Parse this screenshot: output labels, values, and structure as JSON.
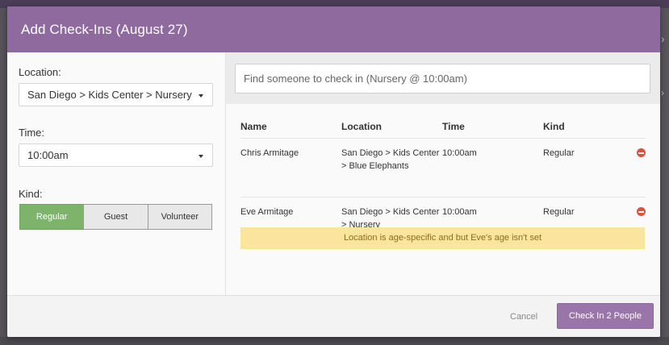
{
  "modal": {
    "title": "Add Check-Ins (August 27)"
  },
  "form": {
    "location_label": "Location:",
    "location_value": "San Diego > Kids Center > Nursery",
    "time_label": "Time:",
    "time_value": "10:00am",
    "kind_label": "Kind:",
    "kind_options": [
      "Regular",
      "Guest",
      "Volunteer"
    ],
    "kind_selected": "Regular"
  },
  "search": {
    "placeholder": "Find someone to check in (Nursery @ 10:00am)"
  },
  "table": {
    "headers": [
      "Name",
      "Location",
      "Time",
      "Kind"
    ],
    "rows": [
      {
        "name": "Chris Armitage",
        "location": "San Diego > Kids Center > Blue Elephants",
        "time": "10:00am",
        "kind": "Regular"
      },
      {
        "name": "Eve Armitage",
        "location": "San Diego > Kids Center > Nursery",
        "time": "10:00am",
        "kind": "Regular"
      }
    ],
    "warning": "Location is age-specific and but Eve's age isn't set"
  },
  "footer": {
    "cancel_label": "Cancel",
    "submit_label": "Check In 2 People"
  },
  "colors": {
    "header_purple": "#8f6a9f",
    "primary_button": "#9a76a8",
    "active_kind": "#7db36b",
    "warning_bg": "#fbe49d",
    "remove_red": "#d9533e"
  }
}
